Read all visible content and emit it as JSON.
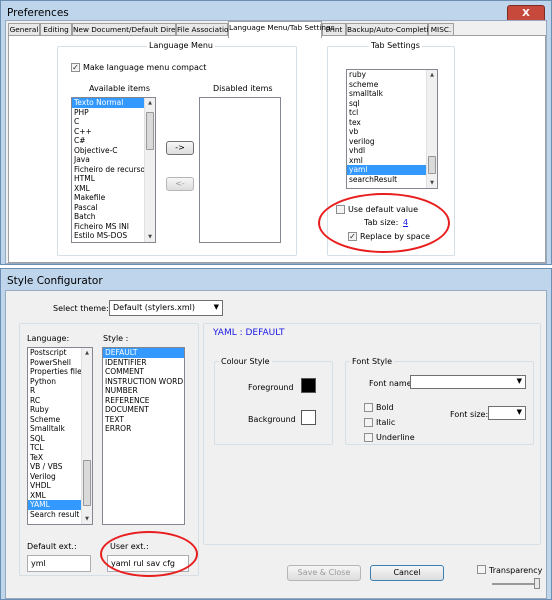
{
  "preferences": {
    "title": "Preferences",
    "close_glyph": "X",
    "tabs": [
      "General",
      "Editing",
      "New Document/Default Directory",
      "File Association",
      "Language Menu/Tab Settings",
      "Print",
      "Backup/Auto-Completion",
      "MISC."
    ],
    "language_menu": {
      "group_title": "Language Menu",
      "compact_label": "Make language menu compact",
      "compact_checked": true,
      "available_title": "Available items",
      "disabled_title": "Disabled items",
      "available_items": [
        "Texto Normal",
        "PHP",
        "C",
        "C++",
        "C#",
        "Objective-C",
        "Java",
        "Ficheiro de recurso",
        "HTML",
        "XML",
        "Makefile",
        "Pascal",
        "Batch",
        "Ficheiro MS INI",
        "Estilo MS-DOS"
      ],
      "selected_item": "Texto Normal",
      "add_button": "->",
      "remove_button": "<-"
    },
    "tab_settings": {
      "group_title": "Tab Settings",
      "languages": [
        "ruby",
        "scheme",
        "smalltalk",
        "sql",
        "tcl",
        "tex",
        "vb",
        "verilog",
        "vhdl",
        "xml",
        "yaml",
        "searchResult"
      ],
      "selected_language": "yaml",
      "use_default_label": "Use default value",
      "use_default_checked": false,
      "tab_size_label": "Tab size:",
      "tab_size_value": "4",
      "replace_label": "Replace by space",
      "replace_checked": true
    }
  },
  "style_configurator": {
    "title": "Style Configurator",
    "select_theme_label": "Select theme:",
    "theme_value": "Default (stylers.xml)",
    "language_label": "Language:",
    "languages": [
      "Postscript",
      "PowerShell",
      "Properties file",
      "Python",
      "R",
      "RC",
      "Ruby",
      "Scheme",
      "Smalltalk",
      "SQL",
      "TCL",
      "TeX",
      "VB / VBS",
      "Verilog",
      "VHDL",
      "XML",
      "YAML",
      "Search result"
    ],
    "selected_language": "YAML",
    "style_label": "Style :",
    "styles": [
      "DEFAULT",
      "IDENTIFIER",
      "COMMENT",
      "INSTRUCTION WORD",
      "NUMBER",
      "REFERENCE",
      "DOCUMENT",
      "TEXT",
      "ERROR"
    ],
    "selected_style": "DEFAULT",
    "heading": "YAML : DEFAULT",
    "colour_style": {
      "title": "Colour Style",
      "foreground_label": "Foreground",
      "foreground_color": "#000000",
      "background_label": "Background",
      "background_color": "#ffffff"
    },
    "font_style": {
      "title": "Font Style",
      "font_name_label": "Font name:",
      "font_size_label": "Font size:",
      "bold_label": "Bold",
      "italic_label": "Italic",
      "underline_label": "Underline"
    },
    "default_ext_label": "Default ext.:",
    "default_ext_value": "yml",
    "user_ext_label": "User ext.:",
    "user_ext_value": "yaml rul sav cfg",
    "save_close_label": "Save & Close",
    "cancel_label": "Cancel",
    "transparency_label": "Transparency"
  },
  "colors": {
    "title_bar": "#bfd5ec",
    "selection": "#3399ff",
    "heading_blue": "#1a1ae6",
    "annotation_red": "#e81e1e"
  },
  "icons": {
    "close": "close-icon",
    "up_arrow": "chevron-up-icon",
    "down_arrow": "chevron-down-icon",
    "checkmark": "check-icon"
  }
}
